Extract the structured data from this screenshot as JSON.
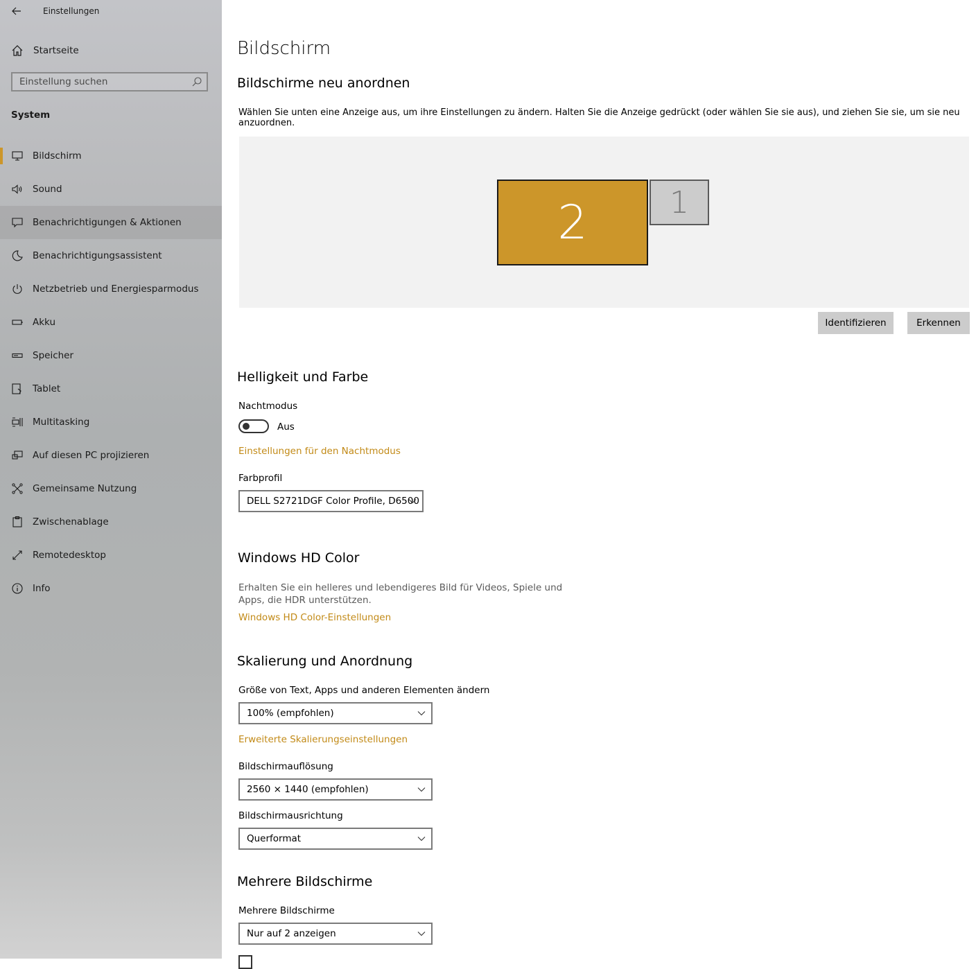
{
  "app": {
    "title": "Einstellungen"
  },
  "sidebar": {
    "home_label": "Startseite",
    "search_placeholder": "Einstellung suchen",
    "section_label": "System",
    "items": [
      {
        "label": "Bildschirm",
        "icon": "monitor-icon"
      },
      {
        "label": "Sound",
        "icon": "speaker-icon"
      },
      {
        "label": "Benachrichtigungen & Aktionen",
        "icon": "notification-icon"
      },
      {
        "label": "Benachrichtigungsassistent",
        "icon": "moon-icon"
      },
      {
        "label": "Netzbetrieb und Energiesparmodus",
        "icon": "power-icon"
      },
      {
        "label": "Akku",
        "icon": "battery-icon"
      },
      {
        "label": "Speicher",
        "icon": "storage-icon"
      },
      {
        "label": "Tablet",
        "icon": "tablet-icon"
      },
      {
        "label": "Multitasking",
        "icon": "multitasking-icon"
      },
      {
        "label": "Auf diesen PC projizieren",
        "icon": "project-icon"
      },
      {
        "label": "Gemeinsame Nutzung",
        "icon": "share-icon"
      },
      {
        "label": "Zwischenablage",
        "icon": "clipboard-icon"
      },
      {
        "label": "Remotedesktop",
        "icon": "remote-desktop-icon"
      },
      {
        "label": "Info",
        "icon": "info-icon"
      }
    ],
    "selected_index": 0,
    "hover_index": 2
  },
  "main": {
    "title": "Bildschirm",
    "arrange": {
      "heading": "Bildschirme neu anordnen",
      "description": "Wählen Sie unten eine Anzeige aus, um ihre Einstellungen zu ändern. Halten Sie die Anzeige gedrückt (oder wählen Sie sie aus), und ziehen Sie sie, um sie neu anzuordnen.",
      "monitor_2_label": "2",
      "monitor_1_label": "1",
      "identify_button": "Identifizieren",
      "detect_button": "Erkennen"
    },
    "brightness": {
      "heading": "Helligkeit und Farbe",
      "night_mode_label": "Nachtmodus",
      "night_mode_state": "Aus",
      "night_mode_link": "Einstellungen für den Nachtmodus",
      "color_profile_label": "Farbprofil",
      "color_profile_value": "DELL S2721DGF Color Profile, D6500"
    },
    "hdr": {
      "heading": "Windows HD Color",
      "description_line1": "Erhalten Sie ein helleres und lebendigeres Bild für Videos, Spiele und",
      "description_line2": "Apps, die HDR unterstützen.",
      "link": "Windows HD Color-Einstellungen"
    },
    "scaling": {
      "heading": "Skalierung und Anordnung",
      "size_label": "Größe von Text, Apps und anderen Elementen ändern",
      "size_value": "100% (empfohlen)",
      "advanced_link": "Erweiterte Skalierungseinstellungen",
      "resolution_label": "Bildschirmauflösung",
      "resolution_value": "2560 × 1440 (empfohlen)",
      "orientation_label": "Bildschirmausrichtung",
      "orientation_value": "Querformat"
    },
    "multiple": {
      "heading": "Mehrere Bildschirme",
      "label": "Mehrere Bildschirme",
      "value": "Nur auf 2 anzeigen"
    }
  },
  "colors": {
    "accent": "#cc962a",
    "link": "#c28a17",
    "sidebar_bg": "#b3b5b6",
    "button_bg": "#cccccc",
    "arrange_bg": "#f2f2f2"
  }
}
